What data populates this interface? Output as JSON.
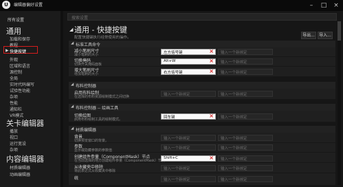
{
  "window": {
    "title": "编辑器偏好设置"
  },
  "search": {
    "placeholder": "搜索设置"
  },
  "sidebar": {
    "all_settings": "所有设置",
    "groups": [
      {
        "title": "通用",
        "items": [
          "加载和保存",
          "教程",
          "快捷按键",
          "外观",
          "区域和语言",
          "源控制",
          "全局",
          "实时代码编写",
          "试验性功能",
          "杂项",
          "性能",
          "通知栏",
          "VR模式"
        ]
      },
      {
        "title": "关卡编辑器",
        "items": [
          "播放",
          "视口",
          "运行宽设",
          "杂项"
        ]
      },
      {
        "title": "内容编辑器",
        "items": [
          "材质编辑器",
          "动画编辑器"
        ]
      }
    ],
    "selected": "快捷按键"
  },
  "page": {
    "title": "通用 - 快捷按键",
    "subtitle": "配置快捷键执行经常使用的操作。",
    "export_label": "导出...",
    "import_label": "导入..."
  },
  "sections": [
    {
      "title": "标准工具命令",
      "rows": [
        {
          "label": "减小笔刷尺寸",
          "desc": "减小笔刷的大小",
          "key1": "左方括号键",
          "key2": "输入一个新绑定"
        },
        {
          "label": "切换掩码",
          "desc": "切换开关掩码面板",
          "key1": "Alt+W",
          "key2": "输入一个新绑定"
        },
        {
          "label": "增大笔刷尺寸",
          "desc": "增加笔刷的大小",
          "key1": "右方括号键",
          "key2": "输入一个新绑定"
        }
      ]
    },
    {
      "title": "布料控制器",
      "rows": [
        {
          "label": "启用布料绘制",
          "desc": "在选择的布料资源绘制模式之间切换",
          "key1": "输入一个新绑定",
          "key2": "输入一个新绑定"
        }
      ]
    },
    {
      "title": "布料控制器 -- 绘画工具",
      "rows": [
        {
          "label": "切换绘图",
          "desc": "启用布料绘制工具的绘制模式。",
          "key1": "回车键",
          "key2": "输入一个新绑定"
        }
      ]
    },
    {
      "title": "材质编辑器",
      "rows": [
        {
          "label": "背景",
          "desc": "切换预览窗口的背景。",
          "key1": "输入一个新绑定",
          "key2": "输入一个新绑定"
        },
        {
          "label": "参数",
          "desc": "显示或隐藏参数的参数值",
          "key1": "输入一个新绑定",
          "key2": "输入一个新绑定"
        },
        {
          "label": "创建组件参量（ComponentMask）节点",
          "desc": "在当前选择的地方创建组件参量（ComponentMask）节点",
          "key1": "Shift+C",
          "key2": "输入一个新绑定"
        },
        {
          "label": "从收藏夹中移除",
          "desc": "将此表达式从收藏夹中移除",
          "key1": "输入一个新绑定",
          "key2": "输入一个新绑定"
        },
        {
          "label": "统",
          "desc": "",
          "key1": "输入一个新绑定",
          "key2": "输入一个新绑定"
        }
      ]
    }
  ]
}
